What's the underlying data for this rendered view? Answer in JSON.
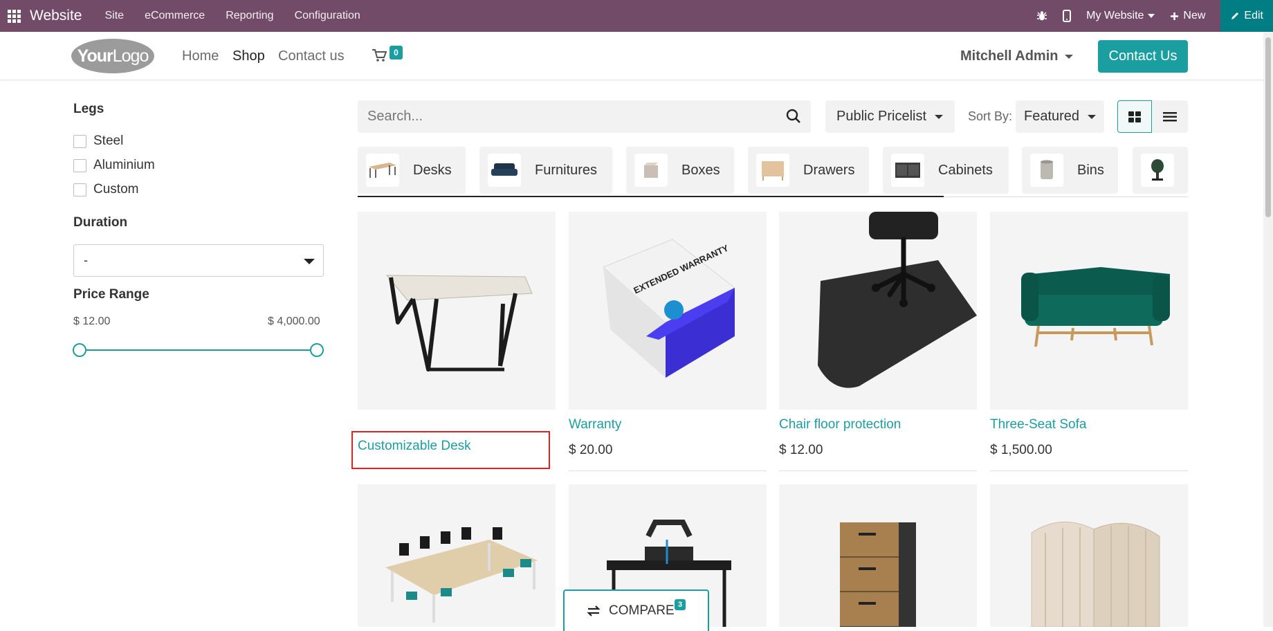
{
  "topbar": {
    "app_name": "Website",
    "menus": [
      "Site",
      "eCommerce",
      "Reporting",
      "Configuration"
    ],
    "website_selector": "My Website",
    "new_label": "New",
    "edit_label": "Edit"
  },
  "header": {
    "logo_text_bold": "Your",
    "logo_text_light": "Logo",
    "nav": [
      "Home",
      "Shop",
      "Contact us"
    ],
    "active_nav": "Shop",
    "cart_count": "0",
    "user_name": "Mitchell Admin",
    "contact_button": "Contact Us"
  },
  "filters": {
    "legs_title": "Legs",
    "legs_options": [
      "Steel",
      "Aluminium",
      "Custom"
    ],
    "duration_title": "Duration",
    "duration_value": "-",
    "price_title": "Price Range",
    "price_min": "$ 12.00",
    "price_max": "$ 4,000.00"
  },
  "toolbar": {
    "search_placeholder": "Search...",
    "pricelist": "Public Pricelist",
    "sort_label": "Sort By:",
    "sort_value": "Featured"
  },
  "categories": [
    "Desks",
    "Furnitures",
    "Boxes",
    "Drawers",
    "Cabinets",
    "Bins"
  ],
  "products": [
    {
      "name": "Customizable Desk",
      "price": ""
    },
    {
      "name": "Warranty",
      "price": "$ 20.00"
    },
    {
      "name": "Chair floor protection",
      "price": "$ 12.00"
    },
    {
      "name": "Three-Seat Sofa",
      "price": "$ 1,500.00"
    }
  ],
  "warranty_box_text": "EXTENDED WARRANTY",
  "compare": {
    "label": "COMPARE",
    "count": "3"
  },
  "colors": {
    "admin_bar": "#714B67",
    "accent": "#1a9ea0",
    "edit": "#017e84",
    "highlight": "#e0211f"
  }
}
